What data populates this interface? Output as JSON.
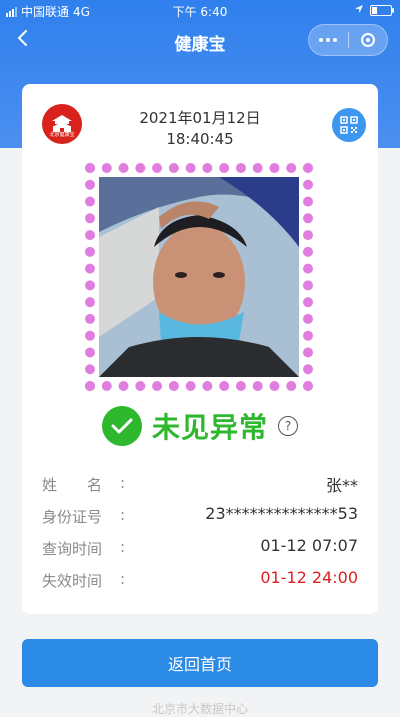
{
  "status_bar": {
    "carrier": "中国联通",
    "network": "4G",
    "time": "下午 6:40"
  },
  "nav": {
    "title": "健康宝",
    "back_icon": "chevron-left-icon",
    "more_icon": "more-dots-icon",
    "close_icon": "target-circle-icon"
  },
  "card": {
    "logo_text": "北京健康宝",
    "date": "2021年01月12日",
    "time": "18:40:45",
    "qr_icon": "qr-code-icon",
    "status_text": "未见异常",
    "status_color": "#2eb82e",
    "help_symbol": "?",
    "info": [
      {
        "label": "姓　　名",
        "colon": ":",
        "value": "张**",
        "highlight": false
      },
      {
        "label": "身份证号",
        "colon": ":",
        "value": "23**************53",
        "highlight": false
      },
      {
        "label": "查询时间",
        "colon": ":",
        "value": "01-12 07:07",
        "highlight": false
      },
      {
        "label": "失效时间",
        "colon": ":",
        "value": "01-12 24:00",
        "highlight": true
      }
    ]
  },
  "actions": {
    "back_home": "返回首页"
  },
  "footer": {
    "text": "北京市大数据中心"
  },
  "colors": {
    "primary": "#2b8ae6",
    "ok_green": "#2eb82e",
    "alert_red": "#e02020",
    "dot_border": "#e07ee0"
  }
}
